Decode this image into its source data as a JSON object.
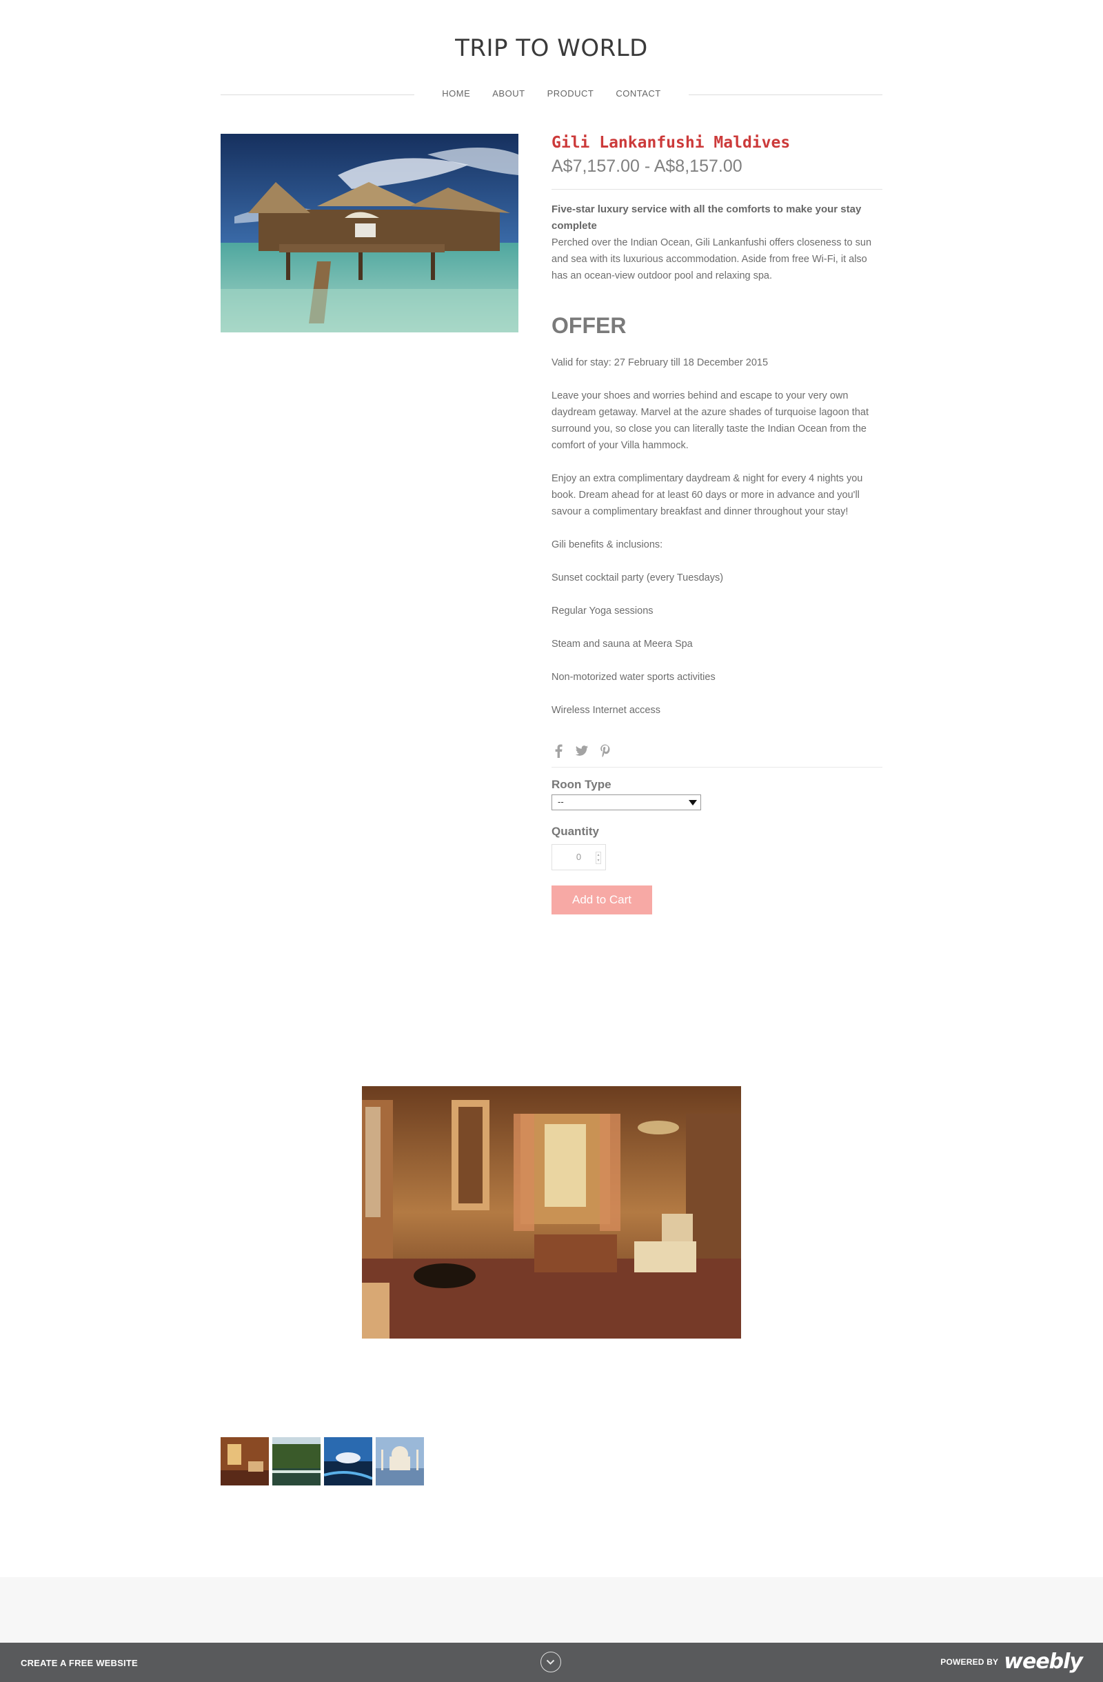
{
  "site": {
    "title": "TRIP TO WORLD"
  },
  "nav": {
    "items": [
      "HOME",
      "ABOUT",
      "PRODUCT",
      "CONTACT"
    ]
  },
  "product": {
    "name": "Gili Lankanfushi Maldives",
    "price": "A$7,157.00 - A$8,157.00",
    "headline": "Five-star luxury service with all the comforts to make your stay complete",
    "intro": "Perched over the Indian Ocean, Gili Lankanfushi offers closeness to sun and sea with its luxurious accommodation. Aside from free Wi-Fi, it also has an ocean-view outdoor pool and relaxing spa.",
    "offer_heading": "OFFER",
    "paragraphs": [
      "Valid for stay: 27 February till 18 December 2015",
      "Leave your shoes and worries behind and escape to your very own daydream getaway. Marvel at the azure shades of turquoise lagoon that surround you, so close you can literally taste the Indian Ocean from the comfort of your Villa hammock.",
      "Enjoy an extra complimentary daydream & night for every 4 nights you book. Dream ahead for at least 60 days or more in advance and you'll savour a complimentary breakfast and dinner throughout your stay!",
      "Gili benefits & inclusions:",
      "Sunset cocktail party (every Tuesdays)",
      "Regular Yoga sessions",
      "Steam and sauna at Meera Spa",
      "Non-motorized water sports activities",
      "Wireless Internet access"
    ],
    "social_icons": [
      "facebook-icon",
      "twitter-icon",
      "pinterest-icon"
    ],
    "room_type_label": "Roon Type",
    "room_type_value": "--",
    "quantity_label": "Quantity",
    "quantity_value": "0",
    "add_to_cart": "Add to Cart"
  },
  "gallery": {
    "thumbnails": [
      "hotel-lobby",
      "resort-pool",
      "night-pool",
      "taj-mahal"
    ]
  },
  "footer": {
    "create_site": "CREATE A FREE WEBSITE",
    "powered_by": "POWERED BY",
    "brand": "weebly"
  },
  "colors": {
    "accent": "#cc3a3a",
    "cart_button": "#f7a9a5",
    "footer_bar": "#595a5c"
  }
}
